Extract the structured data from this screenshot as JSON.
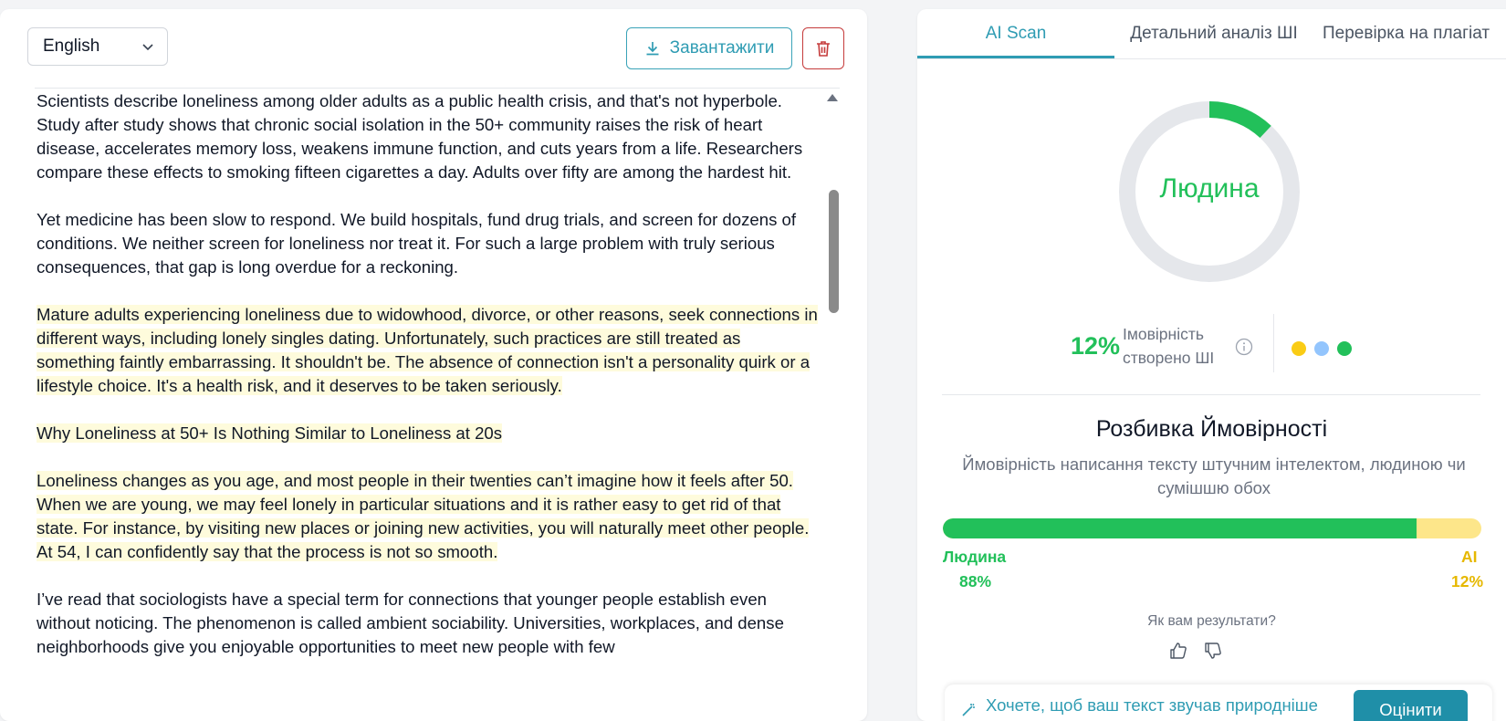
{
  "editor": {
    "language": "English",
    "download_label": "Завантажити",
    "paragraphs": [
      {
        "text": "Scientists describe loneliness among older adults as a public health crisis, and that's not hyperbole. Study after study shows that chronic social isolation in the 50+ community raises the risk of heart disease, accelerates memory loss, weakens immune function, and cuts years from a life. Researchers compare these effects to smoking fifteen cigarettes a day. Adults over fifty are among the hardest hit.",
        "highlight": false
      },
      {
        "text": "Yet medicine has been slow to respond. We build hospitals, fund drug trials, and screen for dozens of conditions. We neither screen for loneliness nor treat it. For such a large problem with truly serious consequences, that gap is long overdue for a reckoning.",
        "highlight": false
      },
      {
        "text": "Mature adults experiencing loneliness due to widowhood, divorce, or other reasons, seek connections in different ways, including lonely singles dating. Unfortunately, such practices are still treated as something faintly embarrassing. It shouldn't be. The absence of connection isn't a personality quirk or a lifestyle choice. It's a health risk, and it deserves to be taken seriously.",
        "highlight": true
      },
      {
        "text": "Why Loneliness at 50+ Is Nothing Similar to Loneliness at 20s",
        "highlight": true
      },
      {
        "text": "Loneliness changes as you age, and most people in their twenties can’t imagine how it feels after 50. When we are young, we may feel lonely in particular situations and it is rather easy to get rid of that state. For instance, by visiting new places or joining new activities, you will naturally meet other people. At 54, I can confidently say that the process is not so smooth.",
        "highlight": true
      },
      {
        "text": "I’ve read that sociologists have a special term for connections that younger people establish even without noticing. The phenomenon is called ambient sociability. Universities, workplaces, and dense neighborhoods give you enjoyable opportunities to meet new people with few",
        "highlight": false
      }
    ]
  },
  "results": {
    "tabs": [
      "AI Scan",
      "Детальний аналіз ШІ",
      "Перевірка на плагіат"
    ],
    "verdict": "Людина",
    "ai_probability": 0.12,
    "ai_probability_text": "12%",
    "probability_label_line1": "Імовірність",
    "probability_label_line2": "створено ШІ",
    "dot_colors": [
      "#facc15",
      "#93c5fd",
      "#22c05a"
    ],
    "breakdown_title": "Розбивка Ймовірності",
    "breakdown_desc": "Ймовірність написання тексту штучним інтелектом, людиною чи сумішшю обох",
    "human_label": "Людина",
    "human_pct": "88%",
    "human_share": 0.88,
    "ai_label": "AI",
    "ai_pct": "12%",
    "feedback_question": "Як вам результати?",
    "promo_text": "Хочете, щоб ваш текст звучав природніше",
    "promo_button": "Оцінити"
  },
  "colors": {
    "accent": "#2f9cb3",
    "human_green": "#22c05a",
    "ai_yellow": "#e6b800",
    "danger": "#c53b3b"
  }
}
